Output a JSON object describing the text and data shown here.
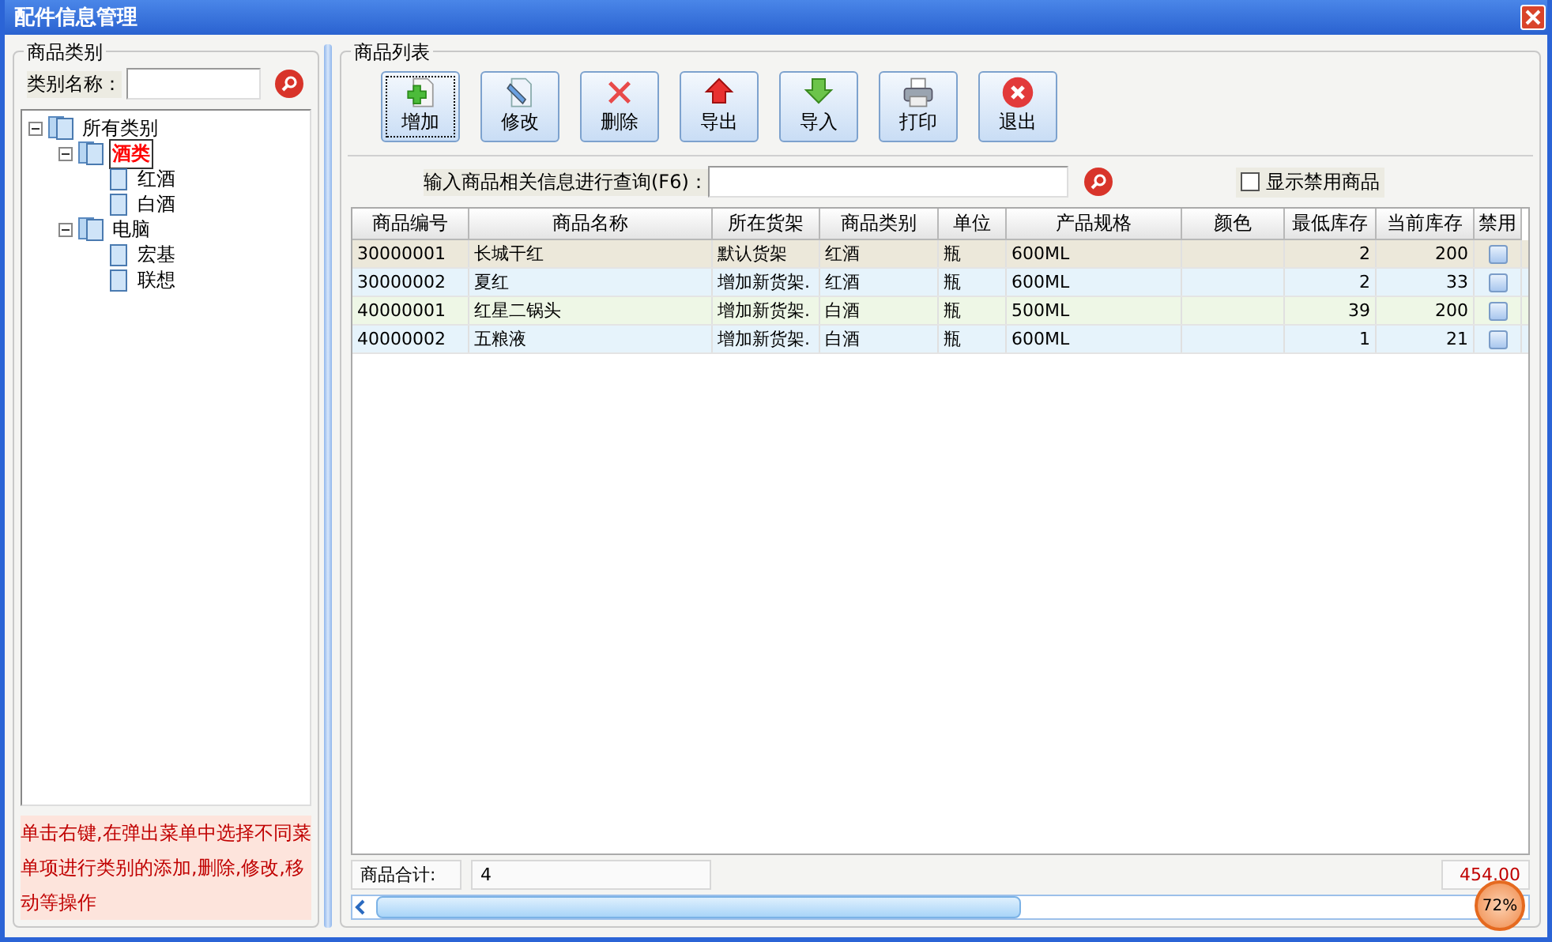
{
  "window": {
    "title": "配件信息管理"
  },
  "category_panel": {
    "legend": "商品类别",
    "search_label": "类别名称：",
    "tree": [
      {
        "label": "所有类别",
        "selected": false,
        "expanded": true,
        "children": [
          {
            "label": "酒类",
            "selected": true,
            "expanded": true,
            "children": [
              {
                "label": "红酒",
                "selected": false
              },
              {
                "label": "白酒",
                "selected": false
              }
            ]
          },
          {
            "label": "电脑",
            "selected": false,
            "expanded": true,
            "children": [
              {
                "label": "宏基",
                "selected": false
              },
              {
                "label": "联想",
                "selected": false
              }
            ]
          }
        ]
      }
    ],
    "hint": "单击右键,在弹出菜单中选择不同菜单项进行类别的添加,删除,修改,移动等操作"
  },
  "product_panel": {
    "legend": "商品列表",
    "toolbar": [
      {
        "label": "增加",
        "kind": "add",
        "focused": true
      },
      {
        "label": "修改",
        "kind": "edit",
        "focused": false
      },
      {
        "label": "删除",
        "kind": "delete",
        "focused": false
      },
      {
        "label": "导出",
        "kind": "export",
        "focused": false
      },
      {
        "label": "导入",
        "kind": "import",
        "focused": false
      },
      {
        "label": "打印",
        "kind": "print",
        "focused": false
      },
      {
        "label": "退出",
        "kind": "exit",
        "focused": false
      }
    ],
    "query_label": "输入商品相关信息进行查询(F6)：",
    "show_disabled": {
      "label": "显示禁用商品",
      "checked": false
    },
    "table": {
      "columns": [
        "商品编号",
        "商品名称",
        "所在货架",
        "商品类别",
        "单位",
        "产品规格",
        "颜色",
        "最低库存",
        "当前库存",
        "禁用"
      ],
      "rows": [
        {
          "selected": true,
          "banned": false,
          "cells": [
            "30000001",
            "长城干红",
            "默认货架",
            "红酒",
            "瓶",
            "600ML",
            "",
            "2",
            "200"
          ]
        },
        {
          "selected": false,
          "banned": false,
          "cells": [
            "30000002",
            "夏红",
            "增加新货架.",
            "红酒",
            "瓶",
            "600ML",
            "",
            "2",
            "33"
          ]
        },
        {
          "selected": false,
          "banned": false,
          "cells": [
            "40000001",
            "红星二锅头",
            "增加新货架.",
            "白酒",
            "瓶",
            "500ML",
            "",
            "39",
            "200"
          ]
        },
        {
          "selected": false,
          "banned": false,
          "cells": [
            "40000002",
            "五粮液",
            "增加新货架.",
            "白酒",
            "瓶",
            "600ML",
            "",
            "1",
            "21"
          ]
        }
      ]
    },
    "footer": {
      "label": "商品合计:",
      "count": "4",
      "total": "454.00"
    }
  },
  "overlay": {
    "text": "72%"
  }
}
